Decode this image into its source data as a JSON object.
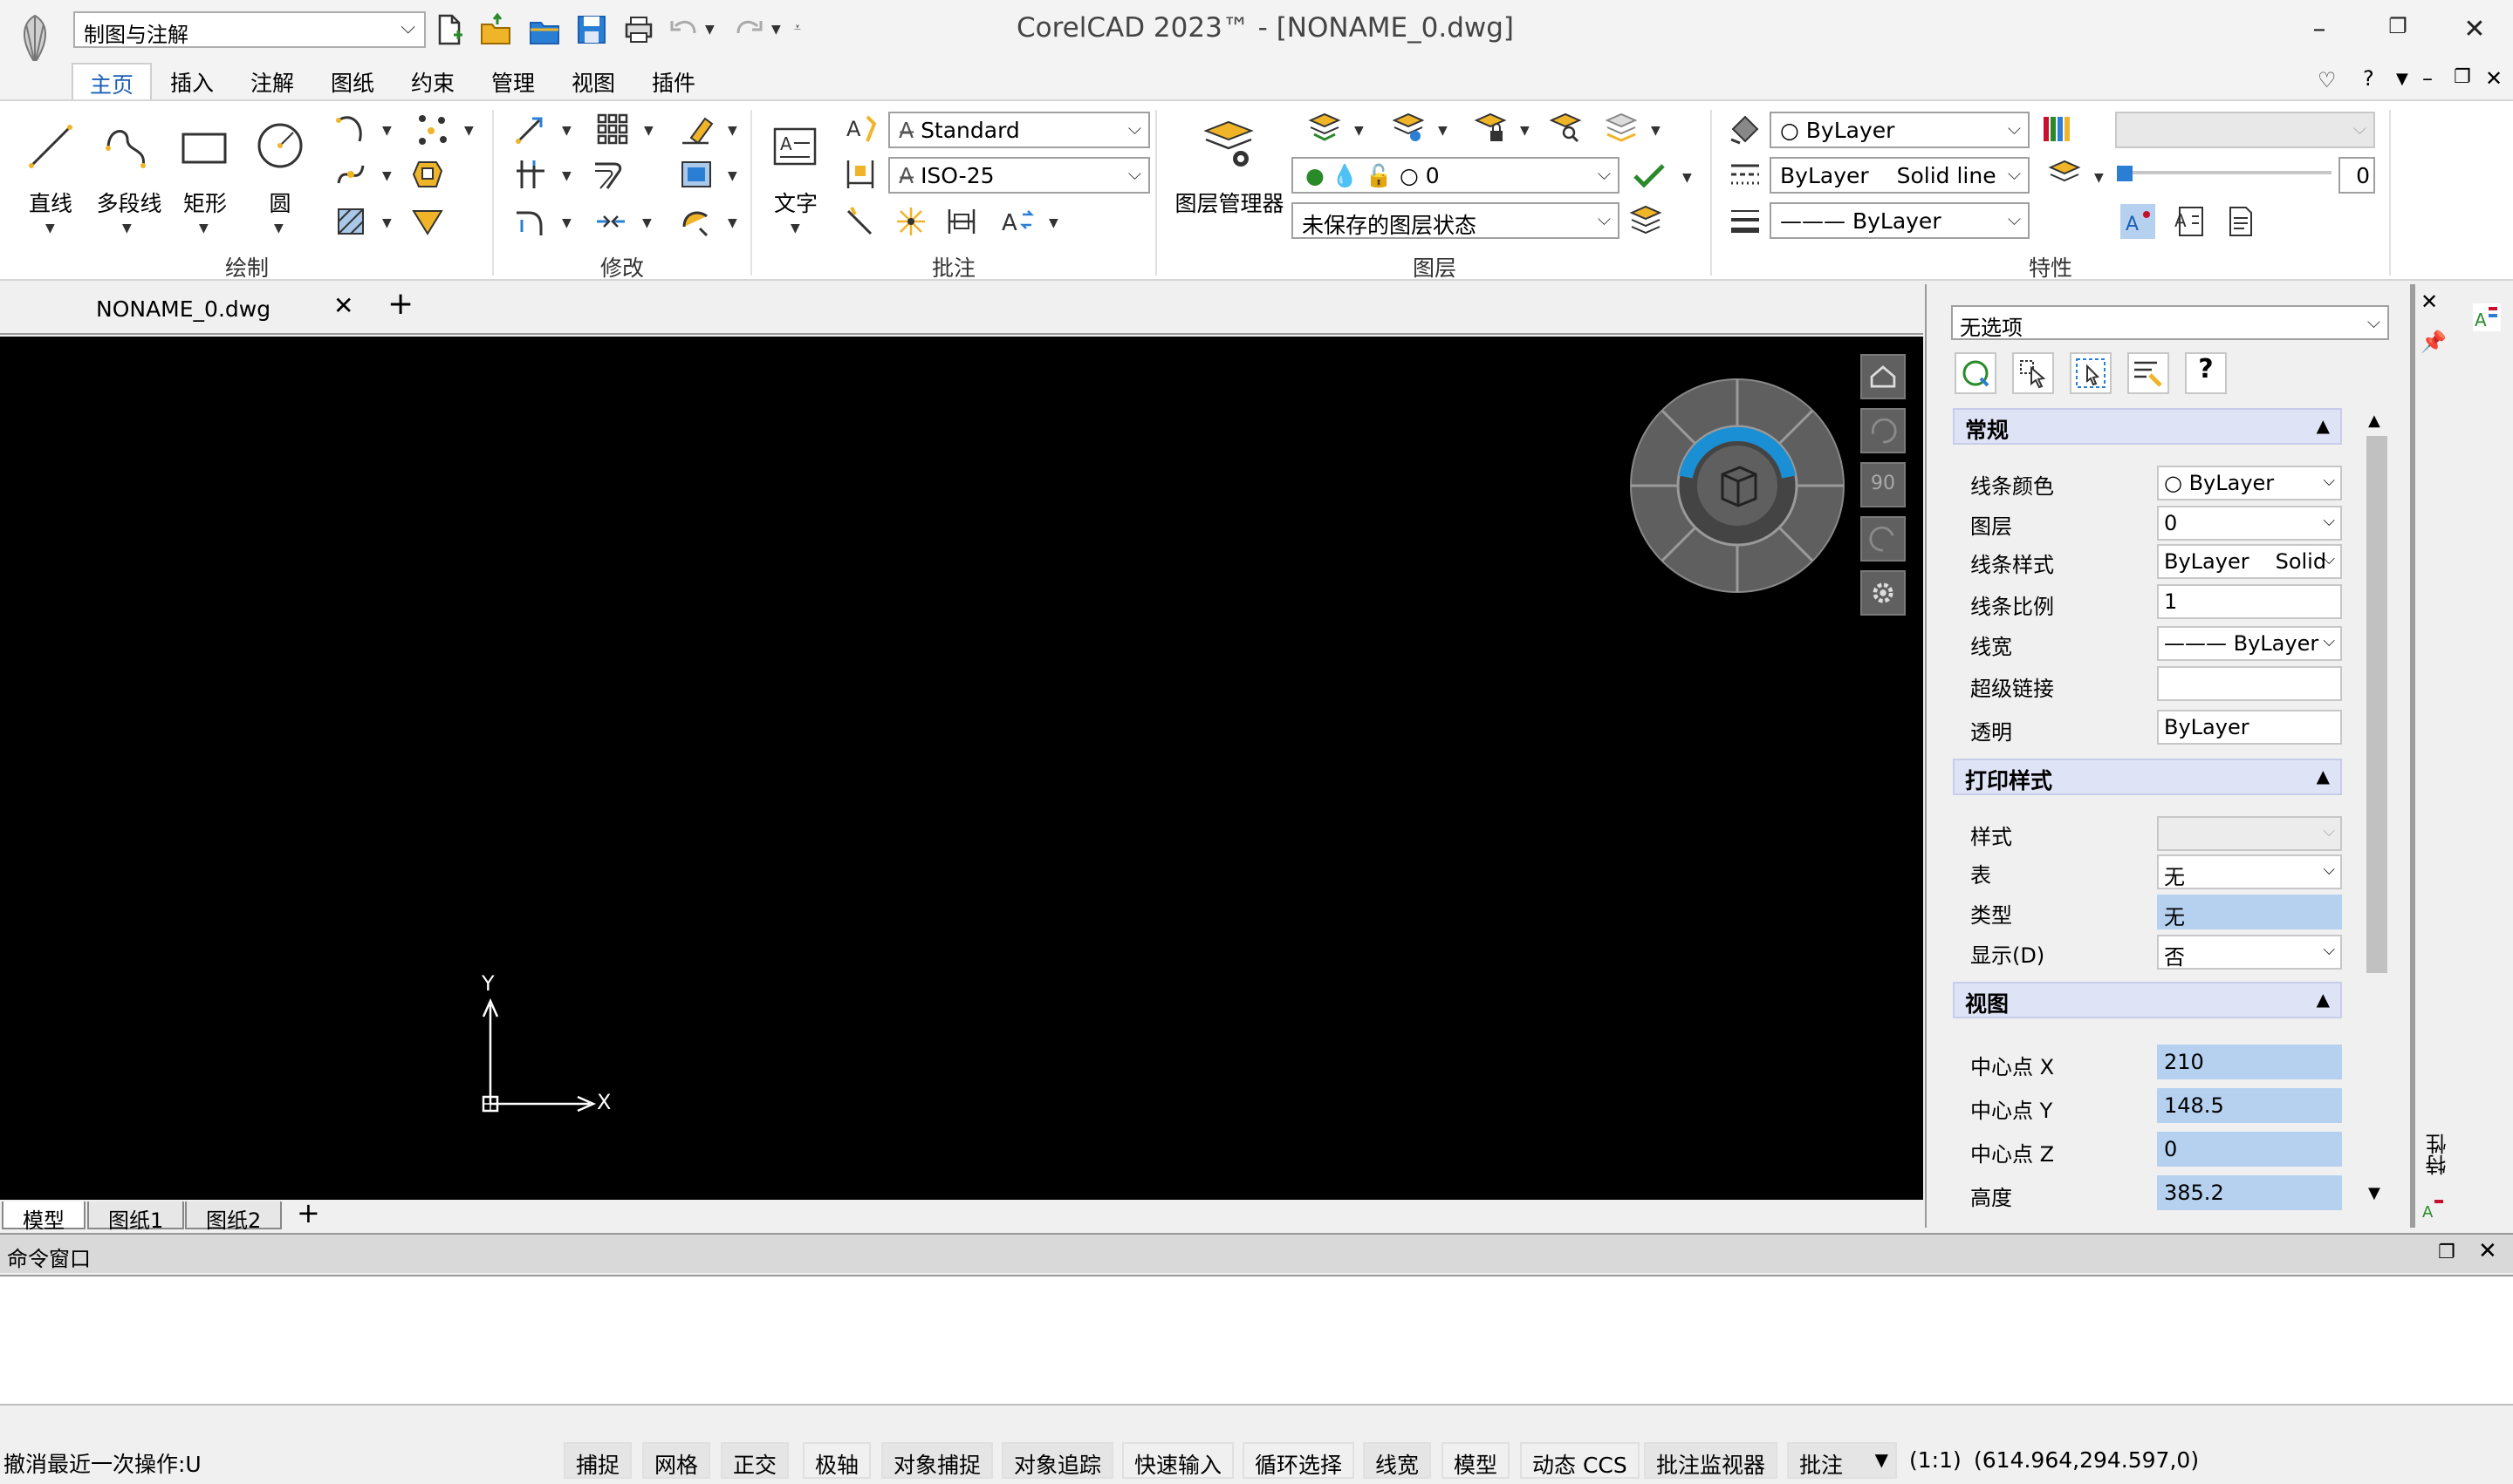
{
  "app": {
    "title": "CorelCAD 2023™ - [NONAME_0.dwg]",
    "workspace": "制图与注解"
  },
  "menu": {
    "tabs": [
      "主页",
      "插入",
      "注解",
      "图纸",
      "约束",
      "管理",
      "视图",
      "插件"
    ]
  },
  "ribbon": {
    "draw": {
      "label": "绘制",
      "line": "直线",
      "polyline": "多段线",
      "rect": "矩形",
      "circle": "圆"
    },
    "modify": {
      "label": "修改"
    },
    "annot": {
      "label": "批注",
      "text": "文字",
      "text_style": "Standard",
      "dim_style": "ISO-25"
    },
    "layers": {
      "label": "图层",
      "manager": "图层管理器",
      "current_layer": "0",
      "layer_state": "未保存的图层状态"
    },
    "props": {
      "label": "特性",
      "color": "ByLayer",
      "linetype_a": "ByLayer",
      "linetype_b": "Solid line",
      "lineweight": "——— ByLayer",
      "transparency": "0"
    }
  },
  "doc": {
    "tab": "NONAME_0.dwg",
    "add": "+"
  },
  "canvas": {
    "x_label": "X",
    "y_label": "Y",
    "view_angle": "90"
  },
  "layout_tabs": [
    "模型",
    "图纸1",
    "图纸2"
  ],
  "properties": {
    "selection": "无选项",
    "help": "?",
    "side_label": "特性",
    "general": {
      "title": "常规",
      "rows": [
        {
          "label": "线条颜色",
          "value": "ByLayer"
        },
        {
          "label": "图层",
          "value": "0"
        },
        {
          "label": "线条样式",
          "value": "ByLayer",
          "value2": "Solid"
        },
        {
          "label": "线条比例",
          "value": "1"
        },
        {
          "label": "线宽",
          "value": "——— ByLayer"
        },
        {
          "label": "超级链接",
          "value": ""
        },
        {
          "label": "透明",
          "value": "ByLayer"
        }
      ]
    },
    "print": {
      "title": "打印样式",
      "rows": [
        {
          "label": "样式",
          "value": ""
        },
        {
          "label": "表",
          "value": "无"
        },
        {
          "label": "类型",
          "value": "无"
        },
        {
          "label": "显示(D)",
          "value": "否"
        }
      ]
    },
    "view": {
      "title": "视图",
      "rows": [
        {
          "label": "中心点 X",
          "value": "210"
        },
        {
          "label": "中心点 Y",
          "value": "148.5"
        },
        {
          "label": "中心点 Z",
          "value": "0"
        },
        {
          "label": "高度",
          "value": "385.2"
        }
      ]
    }
  },
  "command": {
    "title": "命令窗口",
    "prompt": ":"
  },
  "status": {
    "message": "撤消最近一次操作:U",
    "toggles": [
      "捕捉",
      "网格",
      "正交",
      "极轴",
      "对象捕捉",
      "对象追踪",
      "快速输入",
      "循环选择",
      "线宽",
      "模型",
      "动态 CCS",
      "批注监视器"
    ],
    "annotation": "批注",
    "scale": "(1:1)",
    "coords": "(614.964,294.597,0)"
  },
  "colors": {
    "accent": "#1a5fb4",
    "canvas": "#000000",
    "highlight": "#b5d1ef",
    "section_head": "#dfe3f6"
  }
}
